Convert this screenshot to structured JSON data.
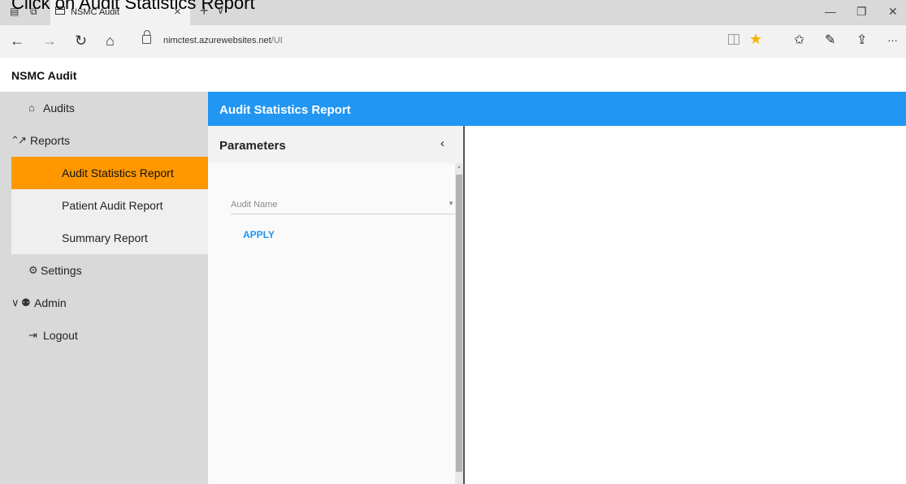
{
  "instruction": "Click on Audit Statistics Report",
  "browser": {
    "tab_title": "NSMC Audit",
    "url_host": "nimctest.azurewebsites.net",
    "url_path": "/UI",
    "more_label": "…"
  },
  "app": {
    "title": "NSMC Audit"
  },
  "sidebar": {
    "items": [
      {
        "label": "Audits",
        "icon": "home-icon"
      },
      {
        "label": "Reports",
        "icon": "chart-line-icon"
      },
      {
        "label": "Settings",
        "icon": "gears-icon"
      },
      {
        "label": "Admin",
        "icon": "admin-icon"
      },
      {
        "label": "Logout",
        "icon": "logout-icon"
      }
    ],
    "reports_sub": [
      {
        "label": "Audit Statistics Report",
        "active": true
      },
      {
        "label": "Patient Audit Report",
        "active": false
      },
      {
        "label": "Summary Report",
        "active": false
      }
    ]
  },
  "content": {
    "title": "Audit Statistics Report",
    "params_title": "Parameters",
    "audit_name_placeholder": "Audit Name",
    "apply_label": "APPLY"
  },
  "colors": {
    "accent_blue": "#2196f3",
    "active_orange": "#ff9800",
    "sidebar_bg": "#d9d9d9"
  }
}
